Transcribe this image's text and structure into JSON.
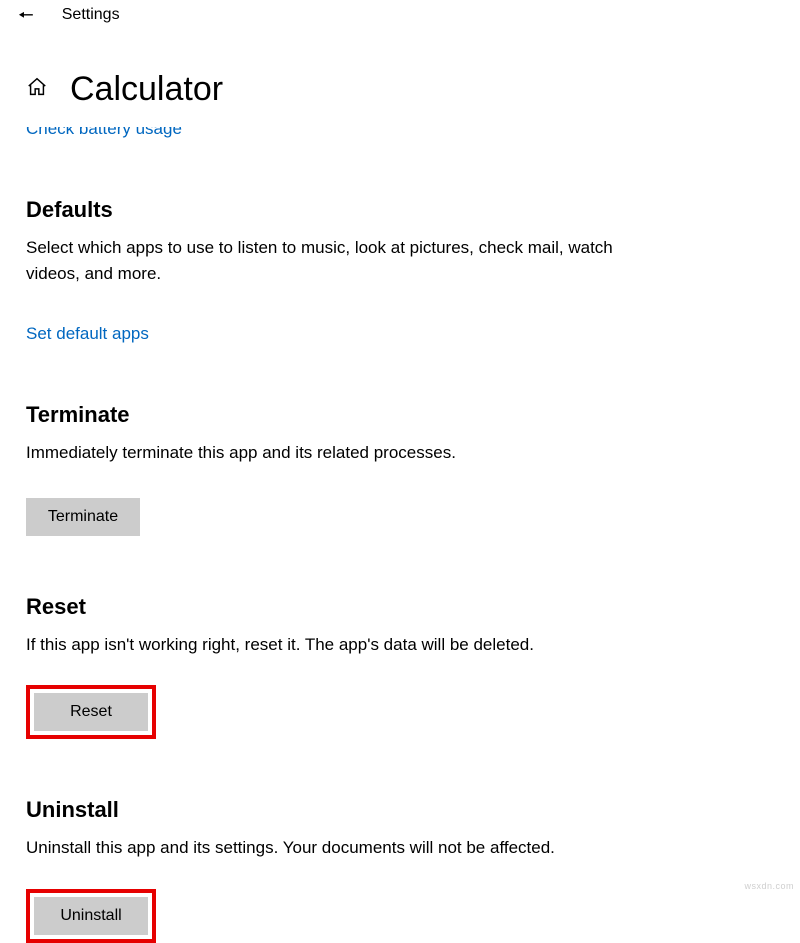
{
  "titlebar": {
    "label": "Settings"
  },
  "header": {
    "title": "Calculator"
  },
  "cutoff_link": "Check battery usage",
  "sections": {
    "defaults": {
      "heading": "Defaults",
      "desc": "Select which apps to use to listen to music, look at pictures, check mail, watch videos, and more.",
      "link": "Set default apps"
    },
    "terminate": {
      "heading": "Terminate",
      "desc": "Immediately terminate this app and its related processes.",
      "button": "Terminate"
    },
    "reset": {
      "heading": "Reset",
      "desc": "If this app isn't working right, reset it. The app's data will be deleted.",
      "button": "Reset"
    },
    "uninstall": {
      "heading": "Uninstall",
      "desc": "Uninstall this app and its settings. Your documents will not be affected.",
      "button": "Uninstall"
    }
  },
  "watermark": "wsxdn.com"
}
